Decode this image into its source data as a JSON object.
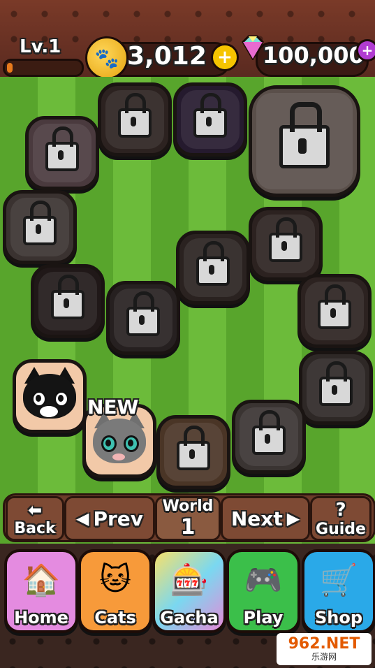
{
  "header": {
    "level_label": "Lv.1",
    "xp_progress": 0.08,
    "coins": "3,012",
    "gems": "100,000",
    "add_symbol": "+"
  },
  "board": {
    "new_badge": "NEW"
  },
  "navigation": {
    "back": "Back",
    "prev": "Prev",
    "world_label": "World",
    "world_number": "1",
    "next": "Next",
    "guide_symbol": "?",
    "guide": "Guide"
  },
  "menu": {
    "home": "Home",
    "cats": "Cats",
    "gacha": "Gacha",
    "play": "Play",
    "shop": "Shop"
  },
  "watermark": {
    "main": "962.NET",
    "sub": "乐游网"
  },
  "colors": {
    "field_light": "#6cbb3a",
    "field_dark": "#58a52c",
    "home": "#e48be0",
    "cats": "#f79a3a",
    "play": "#3bbf4a",
    "shop": "#2aa9e8"
  }
}
